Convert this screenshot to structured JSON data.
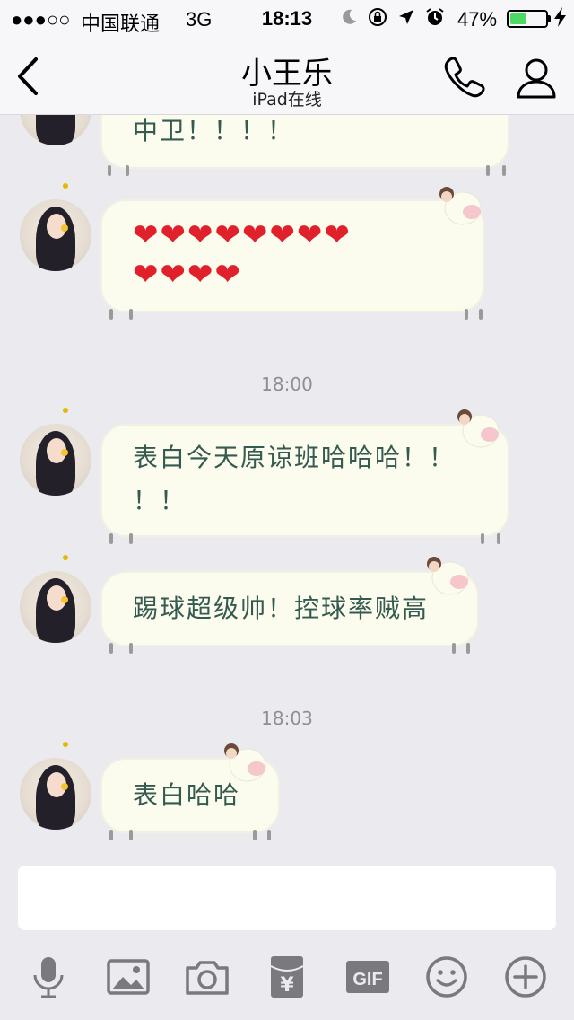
{
  "status_bar": {
    "signal": "●●●○○",
    "carrier": "中国联通",
    "network": "3G",
    "time": "18:13",
    "icons": [
      "moon-icon",
      "rotation-lock-icon",
      "location-arrow-icon",
      "alarm-icon"
    ],
    "battery_percent_text": "47%",
    "battery_level": 0.47,
    "battery_color": "#4cd964"
  },
  "nav": {
    "back_icon": "chevron-left-icon",
    "title": "小王乐",
    "subtitle": "iPad在线",
    "call_icon": "phone-icon",
    "profile_icon": "person-icon"
  },
  "messages": [
    {
      "type": "text",
      "text": "中卫！！！！"
    },
    {
      "type": "hearts",
      "hearts_row1": "❤❤❤❤❤❤❤❤",
      "hearts_row2": "❤❤❤❤"
    },
    {
      "type": "timestamp",
      "text": "18:00"
    },
    {
      "type": "text",
      "text": "表白今天原谅班哈哈哈！！",
      "text_line2": "！！"
    },
    {
      "type": "text",
      "text": "踢球超级帅！控球率贼高"
    },
    {
      "type": "timestamp",
      "text": "18:03"
    },
    {
      "type": "text",
      "text": "表白哈哈"
    }
  ],
  "input": {
    "placeholder": "",
    "value": ""
  },
  "toolbar": {
    "icons": [
      "microphone-icon",
      "image-icon",
      "camera-icon",
      "red-packet-icon",
      "gif-icon",
      "emoji-icon",
      "plus-icon"
    ],
    "gif_label": "GIF",
    "red_packet_symbol": "¥",
    "icon_color": "#7a7a7e"
  },
  "colors": {
    "background": "#eaeaef",
    "bubble": "#fbfbee",
    "bubble_text": "#355a4f",
    "heart": "#e0202a"
  }
}
